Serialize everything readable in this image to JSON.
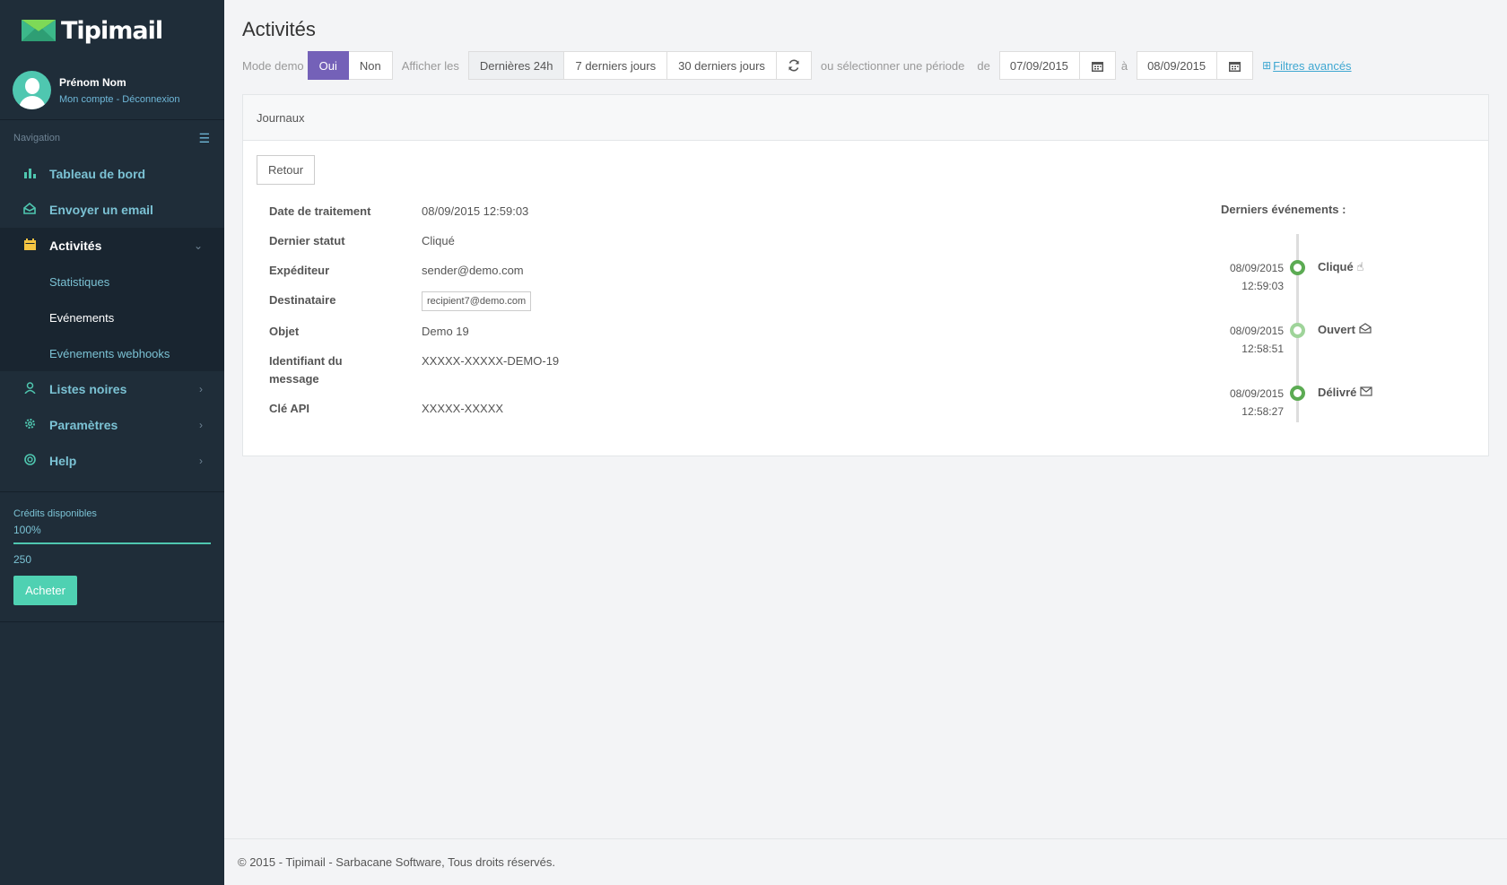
{
  "brand": {
    "name": "Tipimail"
  },
  "user": {
    "name": "Prénom Nom",
    "links": "Mon compte - Déconnexion"
  },
  "nav": {
    "heading": "Navigation",
    "items": [
      {
        "label": "Tableau de bord",
        "icon": "bar-chart-icon"
      },
      {
        "label": "Envoyer un email",
        "icon": "envelope-open-icon"
      },
      {
        "label": "Activités",
        "icon": "calendar-icon",
        "active": true
      },
      {
        "label": "Listes noires",
        "icon": "user-icon"
      },
      {
        "label": "Paramètres",
        "icon": "gear-icon"
      },
      {
        "label": "Help",
        "icon": "lifebuoy-icon"
      }
    ],
    "sub_items": [
      {
        "label": "Statistiques"
      },
      {
        "label": "Evénements",
        "current": true
      },
      {
        "label": "Evénements webhooks"
      }
    ]
  },
  "credits": {
    "label": "Crédits disponibles",
    "percent": "100%",
    "amount": "250",
    "buy": "Acheter",
    "fill": 1.0
  },
  "page": {
    "title": "Activités"
  },
  "toolbar": {
    "demo_label": "Mode demo",
    "demo_yes": "Oui",
    "demo_no": "Non",
    "show_label": "Afficher les",
    "range_24h": "Dernières 24h",
    "range_7d": "7 derniers jours",
    "range_30d": "30 derniers jours",
    "period_label": "ou sélectionner une période",
    "from_label": "de",
    "from_date": "07/09/2015",
    "to_label": "à",
    "to_date": "08/09/2015",
    "filters_link": "Filtres avancés"
  },
  "panel": {
    "title": "Journaux",
    "back": "Retour"
  },
  "details": {
    "rows": [
      {
        "key": "Date de traitement",
        "value": "08/09/2015 12:59:03"
      },
      {
        "key": "Dernier statut",
        "value": "Cliqué"
      },
      {
        "key": "Expéditeur",
        "value": "sender@demo.com"
      },
      {
        "key": "Destinataire",
        "value": "recipient7@demo.com"
      },
      {
        "key": "Objet",
        "value": "Demo 19"
      },
      {
        "key": "Identifiant du message",
        "value": "XXXXX-XXXXX-DEMO-19"
      },
      {
        "key": "Clé API",
        "value": "XXXXX-XXXXX"
      }
    ]
  },
  "events": {
    "title": "Derniers événements :",
    "items": [
      {
        "date": "08/09/2015",
        "time": "12:59:03",
        "name": "Cliqué",
        "icon": "pointer-hand-icon",
        "color": "#5cab53"
      },
      {
        "date": "08/09/2015",
        "time": "12:58:51",
        "name": "Ouvert",
        "icon": "envelope-open-icon",
        "color": "#9fd49a"
      },
      {
        "date": "08/09/2015",
        "time": "12:58:27",
        "name": "Délivré",
        "icon": "envelope-icon",
        "color": "#5cab53"
      }
    ]
  },
  "footer": {
    "text": "© 2015 - Tipimail - Sarbacane Software, Tous droits réservés."
  },
  "colors": {
    "sidebar": "#1f2d39",
    "accent": "#4fd1b2",
    "primary": "#7461b8",
    "link": "#3fa7d1"
  }
}
